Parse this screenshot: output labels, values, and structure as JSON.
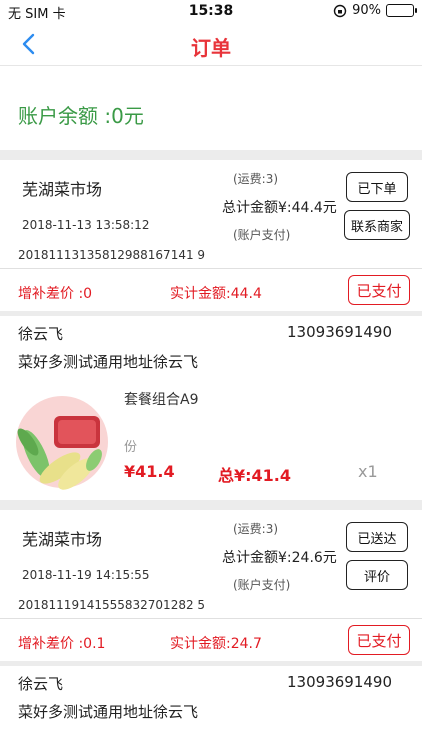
{
  "statusbar": {
    "carrier": "无 SIM 卡",
    "time": "15:38",
    "battery": "90%",
    "battery_level": 0.9
  },
  "nav": {
    "title": "订单"
  },
  "balance": {
    "text": "账户余额 :0元"
  },
  "orders": [
    {
      "shop_name": "芜湖菜市场",
      "date": "2018-11-13 13:58:12",
      "order_no": "20181113135812988167141 9",
      "freight": "(运费:3)",
      "total": "总计金额¥:44.4元",
      "pay_method": "(账户支付)",
      "status_button": "已下单",
      "action_button": "联系商家",
      "diff": "增补差价 :0",
      "actual": "实计金额:44.4",
      "pay_status": "已支付",
      "customer_name": "徐云飞",
      "phone": "13093691490",
      "address": "菜好多测试通用地址徐云飞",
      "product_name": "套餐组合A9",
      "unit": "份",
      "price": "¥41.4",
      "sum": "总¥:41.4",
      "qty": "x1"
    },
    {
      "shop_name": "芜湖菜市场",
      "date": "2018-11-19 14:15:55",
      "order_no": "20181119141555832701282 5",
      "freight": "(运费:3)",
      "total": "总计金额¥:24.6元",
      "pay_method": "(账户支付)",
      "status_button": "已送达",
      "action_button": "评价",
      "diff": "增补差价 :0.1",
      "actual": "实计金额:24.7",
      "pay_status": "已支付",
      "customer_name": "徐云飞",
      "phone": "13093691490",
      "address": "菜好多测试通用地址徐云飞"
    }
  ]
}
